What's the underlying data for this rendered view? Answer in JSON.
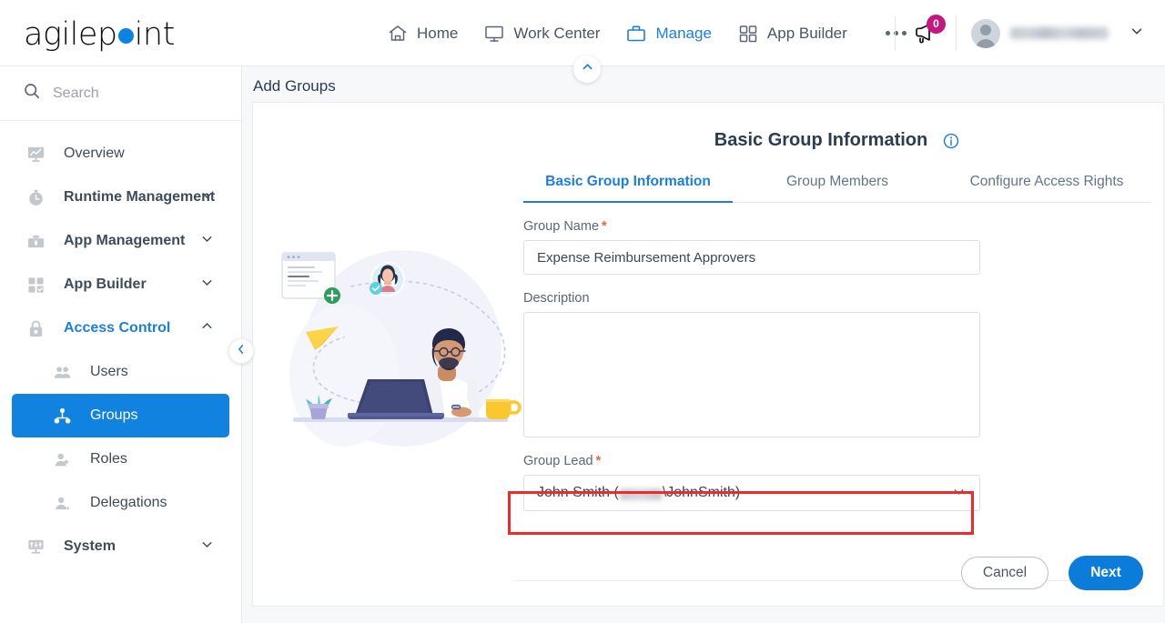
{
  "brand": {
    "name_part1": "agilep",
    "name_part2": "int",
    "dot_color": "#0a84e0"
  },
  "topnav": {
    "items": [
      {
        "label": "Home",
        "icon": "home-icon",
        "active": false
      },
      {
        "label": "Work Center",
        "icon": "monitor-icon",
        "active": false
      },
      {
        "label": "Manage",
        "icon": "briefcase-icon",
        "active": true
      },
      {
        "label": "App Builder",
        "icon": "grid-icon",
        "active": false
      }
    ],
    "more_icon": "ellipsis-icon",
    "announcement": {
      "icon": "megaphone-icon",
      "badge_count": "0",
      "badge_color": "#c2187f"
    },
    "user": {
      "avatar": "avatar-icon",
      "name": "",
      "chevron": "chevron-down-icon"
    }
  },
  "sidebar": {
    "search": {
      "placeholder": "Search",
      "icon": "search-icon"
    },
    "items": [
      {
        "label": "Overview",
        "icon": "chart-monitor-icon",
        "level": 0,
        "expandable": false,
        "state": "normal"
      },
      {
        "label": "Runtime Management",
        "icon": "stopwatch-icon",
        "level": 0,
        "expandable": true,
        "state": "bold"
      },
      {
        "label": "App Management",
        "icon": "toolbox-icon",
        "level": 0,
        "expandable": true,
        "state": "bold"
      },
      {
        "label": "App Builder",
        "icon": "grid-check-icon",
        "level": 0,
        "expandable": true,
        "state": "bold"
      },
      {
        "label": "Access Control",
        "icon": "lock-icon",
        "level": 0,
        "expandable": true,
        "expanded": true,
        "state": "accent"
      },
      {
        "label": "Users",
        "icon": "users-icon",
        "level": 1,
        "expandable": false,
        "state": "normal"
      },
      {
        "label": "Groups",
        "icon": "org-chart-icon",
        "level": 1,
        "expandable": false,
        "state": "active"
      },
      {
        "label": "Roles",
        "icon": "user-badge-icon",
        "level": 1,
        "expandable": false,
        "state": "normal"
      },
      {
        "label": "Delegations",
        "icon": "user-delegate-icon",
        "level": 1,
        "expandable": false,
        "state": "normal"
      },
      {
        "label": "System",
        "icon": "sliders-icon",
        "level": 0,
        "expandable": true,
        "state": "bold"
      }
    ],
    "collapse_icon": "chevron-left-icon"
  },
  "page": {
    "title": "Add Groups",
    "collapse_icon": "chevron-up-icon"
  },
  "form": {
    "heading": "Basic Group Information",
    "info_icon": "info-circle-icon",
    "tabs": [
      {
        "label": "Basic Group Information",
        "active": true
      },
      {
        "label": "Group Members",
        "active": false
      },
      {
        "label": "Configure Access Rights",
        "active": false
      }
    ],
    "fields": {
      "group_name": {
        "label": "Group Name",
        "required": true,
        "value": "Expense Reimbursement Approvers",
        "placeholder": ""
      },
      "description": {
        "label": "Description",
        "required": false,
        "value": "",
        "placeholder": ""
      },
      "group_lead": {
        "label": "Group Lead",
        "required": true,
        "value_prefix": "John Smith (",
        "value_redacted": true,
        "value_suffix": "\\JohnSmith)",
        "chevron": "chevron-down-icon",
        "highlighted": true,
        "highlight_color": "#ee2b28"
      }
    },
    "buttons": {
      "cancel": "Cancel",
      "next": "Next"
    }
  },
  "illustration": {
    "name": "team-collaboration-illustration",
    "elements": [
      "browser-card",
      "plus-badge",
      "avatar-bubble",
      "paper-plane",
      "person-at-laptop",
      "plant",
      "coffee-mug",
      "dotted-path"
    ]
  }
}
